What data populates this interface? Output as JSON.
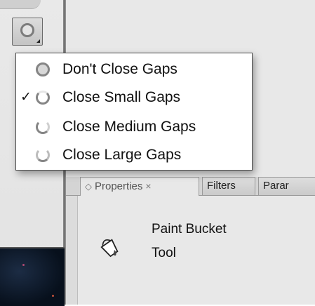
{
  "toolbar": {
    "gap_button_icon": "gap-size-icon"
  },
  "gap_menu": {
    "items": [
      {
        "label": "Don't Close Gaps",
        "checked": false,
        "icon": "no-gap-icon"
      },
      {
        "label": "Close Small Gaps",
        "checked": true,
        "icon": "small-gap-icon"
      },
      {
        "label": "Close Medium Gaps",
        "checked": false,
        "icon": "medium-gap-icon"
      },
      {
        "label": "Close Large Gaps",
        "checked": false,
        "icon": "large-gap-icon"
      }
    ],
    "check_mark": "✓"
  },
  "panel": {
    "tabs": [
      {
        "label": "Properties",
        "active": true
      },
      {
        "label": "Filters",
        "active": false
      },
      {
        "label": "Parar",
        "active": false
      }
    ],
    "tab_close": "×",
    "tab_icon": "◇",
    "tool_name_line1": "Paint Bucket",
    "tool_name_line2": "Tool",
    "tool_icon": "paint-bucket-icon"
  }
}
